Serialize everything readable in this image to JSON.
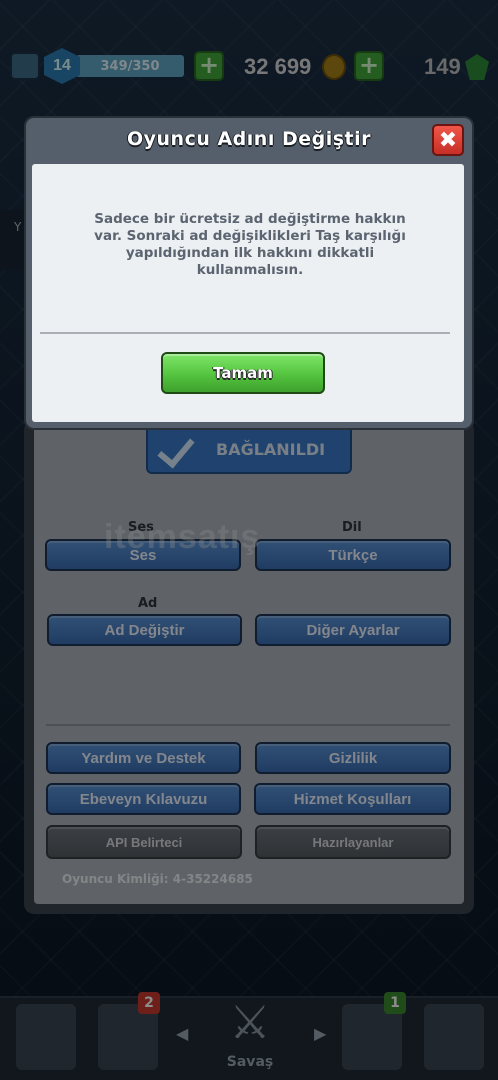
{
  "topbar": {
    "level": "14",
    "xp": "349/350",
    "gold": "32 699",
    "gems": "149"
  },
  "modal": {
    "title": "Oyuncu Adını Değiştir",
    "close_icon": "✖",
    "message": "Sadece bir ücretsiz ad değiştirme hakkın var. Sonraki ad değişiklikleri Taş karşılığı yapıldığından ilk hakkını dikkatli kullanmalısın.",
    "ok_label": "Tamam"
  },
  "settings": {
    "connected_label": "BAĞLANILDI",
    "sound_heading": "Ses",
    "sound_button": "Ses",
    "language_heading": "Dil",
    "language_button": "Türkçe",
    "name_heading": "Ad",
    "change_name_button": "Ad Değiştir",
    "other_settings_button": "Diğer Ayarlar",
    "help_button": "Yardım ve Destek",
    "privacy_button": "Gizlilik",
    "parents_guide_button": "Ebeveyn Kılavuzu",
    "terms_button": "Hizmet Koşulları",
    "api_token_button": "API Belirteci",
    "credits_button": "Hazırlayanlar",
    "player_id": "Oyuncu Kimliği: 4-35224685"
  },
  "watermark": "itemsatış",
  "bottom_nav": {
    "cards_badge": "2",
    "clan_badge": "1",
    "battle_label": "Savaş"
  },
  "colors": {
    "ok_green": "#54c43f",
    "settings_blue": "#3a6db3",
    "close_red": "#c62f26"
  }
}
